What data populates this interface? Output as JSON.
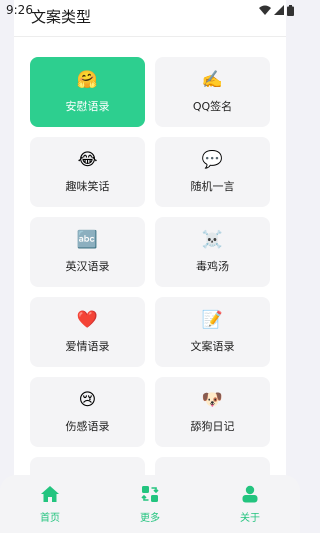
{
  "status_bar": {
    "time": "9:26"
  },
  "page": {
    "title": "文案类型"
  },
  "categories": [
    {
      "label": "安慰语录",
      "icon": "🤗",
      "active": true
    },
    {
      "label": "QQ签名",
      "icon": "✍️"
    },
    {
      "label": "趣味笑话",
      "icon": "😂"
    },
    {
      "label": "随机一言",
      "icon": "💬"
    },
    {
      "label": "英汉语录",
      "icon": "🔤"
    },
    {
      "label": "毒鸡汤",
      "icon": "☠️"
    },
    {
      "label": "爱情语录",
      "icon": "❤️"
    },
    {
      "label": "文案语录",
      "icon": "📝"
    },
    {
      "label": "伤感语录",
      "icon": "😢"
    },
    {
      "label": "舔狗日记",
      "icon": "🐶"
    },
    {
      "label": "",
      "icon": "✍️"
    },
    {
      "label": "",
      "icon": "📜"
    }
  ],
  "tabbar": {
    "home": "首页",
    "more": "更多",
    "about": "关于"
  },
  "colors": {
    "accent": "#2dcf8f",
    "tab": "#23c47f"
  }
}
